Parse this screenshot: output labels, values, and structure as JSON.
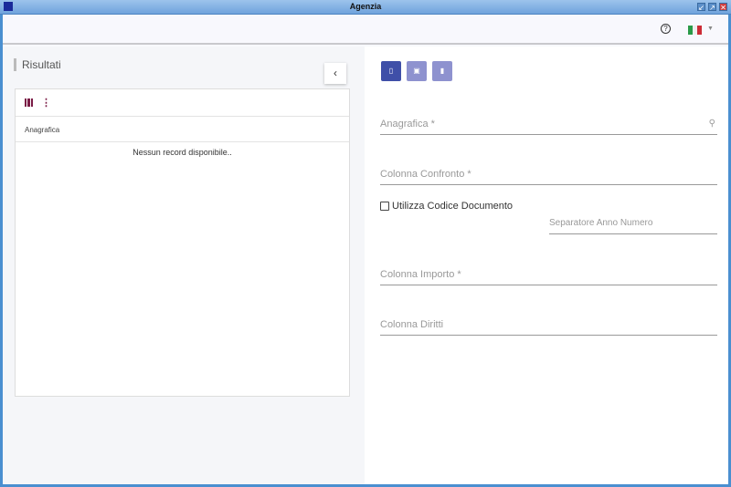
{
  "window": {
    "title": "Agenzia"
  },
  "header": {
    "help_icon": "?",
    "language": "Italiano"
  },
  "left": {
    "title": "Risultati",
    "collapse_icon": "‹",
    "grid": {
      "column_header": "Anagrafica",
      "empty_message": "Nessun record disponibile.."
    }
  },
  "right": {
    "buttons": {
      "new": "new-document-icon",
      "save": "save-icon",
      "delete": "delete-icon"
    },
    "fields": {
      "anagrafica": "Anagrafica *",
      "colonna_confronto": "Colonna Confronto *",
      "utilizza_codice": "Utilizza Codice Documento",
      "separatore": "Separatore Anno Numero",
      "colonna_importo": "Colonna Importo *",
      "colonna_diritti": "Colonna Diritti"
    }
  },
  "colors": {
    "primary": "#3f4fa8",
    "secondary": "#8e92cf",
    "accent": "#7a1b45"
  }
}
